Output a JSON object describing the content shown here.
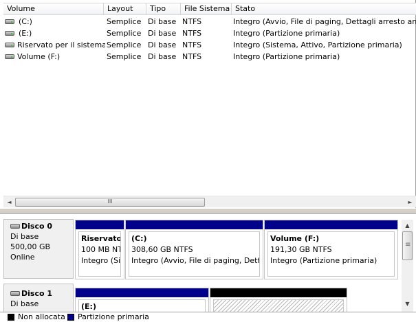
{
  "columns": {
    "volume": "Volume",
    "layout": "Layout",
    "tipo": "Tipo",
    "file_system": "File Sistema",
    "stato": "Stato"
  },
  "volumes": [
    {
      "name": "(C:)",
      "layout": "Semplice",
      "tipo": "Di base",
      "fs": "NTFS",
      "stato": "Integro (Avvio, File di paging, Dettagli arresto ano"
    },
    {
      "name": "(E:)",
      "layout": "Semplice",
      "tipo": "Di base",
      "fs": "NTFS",
      "stato": "Integro (Partizione primaria)"
    },
    {
      "name": "Riservato per il sistema",
      "layout": "Semplice",
      "tipo": "Di base",
      "fs": "NTFS",
      "stato": "Integro (Sistema, Attivo, Partizione primaria)"
    },
    {
      "name": "Volume (F:)",
      "layout": "Semplice",
      "tipo": "Di base",
      "fs": "NTFS",
      "stato": "Integro (Partizione primaria)"
    }
  ],
  "hscroll": {
    "left_arrow": "◄",
    "right_arrow": "►",
    "grip": "III"
  },
  "vscroll": {
    "up_arrow": "▲",
    "down_arrow": "▼"
  },
  "disks": [
    {
      "title": "Disco 0",
      "type": "Di base",
      "size": "500,00 GB",
      "status": "Online",
      "partitions": [
        {
          "name": "Riservato",
          "size": "100 MB NT",
          "status": "Integro (Sis"
        },
        {
          "name": "(C:)",
          "size": "308,60 GB NTFS",
          "status": "Integro (Avvio, File di paging, Detta"
        },
        {
          "name": "Volume  (F:)",
          "size": "191,30 GB NTFS",
          "status": "Integro (Partizione primaria)"
        }
      ]
    },
    {
      "title": "Disco 1",
      "type": "Di base",
      "partitions": [
        {
          "name": "(E:)"
        }
      ]
    }
  ],
  "legend": {
    "unallocated": "Non allocata",
    "primary": "Partizione primaria"
  },
  "colors": {
    "primary_partition": "#00008b",
    "unallocated": "#000000"
  }
}
